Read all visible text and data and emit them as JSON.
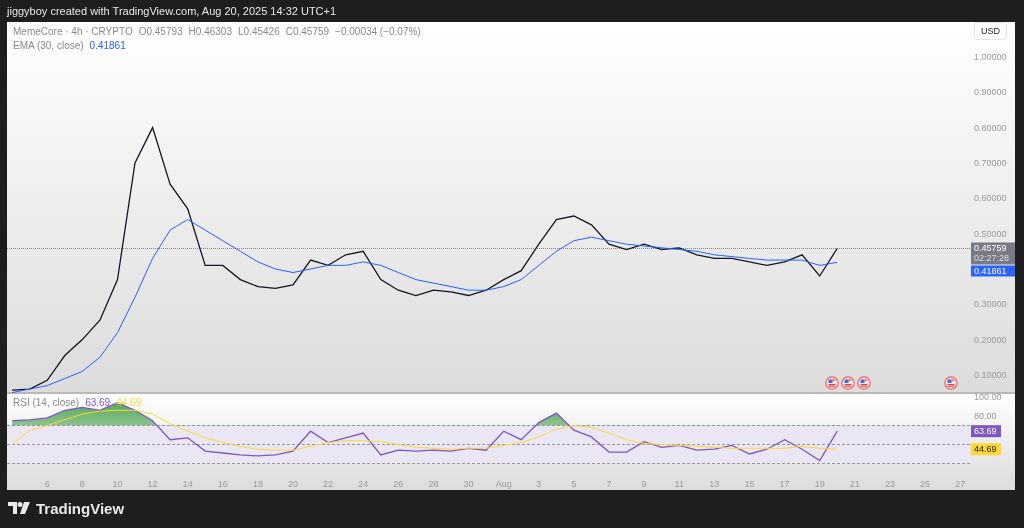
{
  "header": {
    "caption": "jiggyboy created with TradingView.com, Aug 20, 2025 14:32 UTC+1"
  },
  "chart": {
    "ohlc": [
      "O0.45793",
      "H0.46303",
      "L0.45426",
      "C0.45759"
    ],
    "change": "−0.00034 (−0.07%)",
    "ema_value": "0.41861",
    "currency": "USD",
    "price_badge": {
      "value": "0.45759",
      "countdown": "02:27:28"
    },
    "ema_badge": "0.41861",
    "events": [
      {
        "kind": "flag"
      },
      {
        "kind": "flag"
      },
      {
        "kind": "flag"
      },
      {
        "kind": "flag"
      }
    ],
    "chart_data": {
      "type": "line",
      "x": [
        "2025-07-04",
        "2025-07-05",
        "2025-07-06",
        "2025-07-07",
        "2025-07-08",
        "2025-07-09",
        "2025-07-10",
        "2025-07-11",
        "2025-07-12",
        "2025-07-13",
        "2025-07-14",
        "2025-07-15",
        "2025-07-16",
        "2025-07-17",
        "2025-07-18",
        "2025-07-19",
        "2025-07-20",
        "2025-07-21",
        "2025-07-22",
        "2025-07-23",
        "2025-07-24",
        "2025-07-25",
        "2025-07-26",
        "2025-07-27",
        "2025-07-28",
        "2025-07-29",
        "2025-07-30",
        "2025-07-31",
        "2025-08-01",
        "2025-08-02",
        "2025-08-03",
        "2025-08-04",
        "2025-08-05",
        "2025-08-06",
        "2025-08-07",
        "2025-08-08",
        "2025-08-09",
        "2025-08-10",
        "2025-08-11",
        "2025-08-12",
        "2025-08-13",
        "2025-08-14",
        "2025-08-15",
        "2025-08-16",
        "2025-08-17",
        "2025-08-18",
        "2025-08-19",
        "2025-08-20"
      ],
      "series": [
        {
          "name": "MemeCore · 4h · CRYPTO",
          "color": "#131722",
          "values": [
            0.057,
            0.06,
            0.085,
            0.155,
            0.2,
            0.255,
            0.37,
            0.7,
            0.8,
            0.64,
            0.57,
            0.41,
            0.41,
            0.37,
            0.35,
            0.345,
            0.355,
            0.425,
            0.41,
            0.44,
            0.45,
            0.37,
            0.34,
            0.325,
            0.34,
            0.335,
            0.325,
            0.34,
            0.37,
            0.395,
            0.47,
            0.54,
            0.55,
            0.525,
            0.47,
            0.455,
            0.47,
            0.455,
            0.46,
            0.44,
            0.43,
            0.43,
            0.42,
            0.41,
            0.42,
            0.44,
            0.38,
            0.458
          ]
        },
        {
          "name": "EMA (30, close)",
          "color": "#2962ff",
          "values": [
            0.05,
            0.06,
            0.07,
            0.09,
            0.11,
            0.15,
            0.22,
            0.32,
            0.43,
            0.51,
            0.54,
            0.51,
            0.48,
            0.45,
            0.42,
            0.4,
            0.39,
            0.4,
            0.41,
            0.41,
            0.42,
            0.41,
            0.39,
            0.37,
            0.36,
            0.35,
            0.34,
            0.34,
            0.35,
            0.37,
            0.41,
            0.45,
            0.48,
            0.49,
            0.48,
            0.47,
            0.465,
            0.46,
            0.455,
            0.45,
            0.44,
            0.435,
            0.43,
            0.425,
            0.425,
            0.425,
            0.41,
            0.419
          ]
        }
      ],
      "xlim": [
        "2025-07-03T17:00",
        "2025-08-30T03:00"
      ],
      "ylim": [
        0.049,
        1.099
      ],
      "yticks": [
        {
          "value": 1,
          "label": "1.00000"
        },
        {
          "value": 0.9,
          "label": "0.90000"
        },
        {
          "value": 0.8,
          "label": "0.80000"
        },
        {
          "value": 0.7,
          "label": "0.70000"
        },
        {
          "value": 0.6,
          "label": "0.60000"
        },
        {
          "value": 0.5,
          "label": "0.50000"
        },
        {
          "value": 0.3,
          "label": "0.30000"
        },
        {
          "value": 0.2,
          "label": "0.20000"
        },
        {
          "value": 0.1,
          "label": "0.10000"
        }
      ]
    }
  },
  "rsi": {
    "value": "63.69",
    "ma_value": "44.69",
    "value_badge": "63.69",
    "ma_badge": "44.69",
    "chart_data": {
      "type": "line",
      "x": [
        "2025-07-04",
        "2025-07-05",
        "2025-07-06",
        "2025-07-07",
        "2025-07-08",
        "2025-07-09",
        "2025-07-10",
        "2025-07-11",
        "2025-07-12",
        "2025-07-13",
        "2025-07-14",
        "2025-07-15",
        "2025-07-16",
        "2025-07-17",
        "2025-07-18",
        "2025-07-19",
        "2025-07-20",
        "2025-07-21",
        "2025-07-22",
        "2025-07-23",
        "2025-07-24",
        "2025-07-25",
        "2025-07-26",
        "2025-07-27",
        "2025-07-28",
        "2025-07-29",
        "2025-07-30",
        "2025-07-31",
        "2025-08-01",
        "2025-08-02",
        "2025-08-03",
        "2025-08-04",
        "2025-08-05",
        "2025-08-06",
        "2025-08-07",
        "2025-08-08",
        "2025-08-09",
        "2025-08-10",
        "2025-08-11",
        "2025-08-12",
        "2025-08-13",
        "2025-08-14",
        "2025-08-15",
        "2025-08-16",
        "2025-08-17",
        "2025-08-18",
        "2025-08-19",
        "2025-08-20"
      ],
      "series": [
        {
          "name": "RSI (14, close)",
          "color": "#7e57c2",
          "values": [
            75,
            76,
            78,
            86,
            89,
            86,
            94,
            86,
            75,
            55,
            57,
            43,
            41,
            39,
            38,
            39,
            43,
            64,
            52,
            57,
            62,
            39,
            44,
            43,
            44,
            43,
            46,
            44,
            64,
            55,
            73,
            83,
            65,
            58,
            42,
            42,
            53,
            47,
            49,
            44,
            45,
            49,
            40,
            45,
            55,
            45,
            33,
            64
          ]
        },
        {
          "color": "#fdd835",
          "values": [
            50,
            65,
            70,
            76,
            82,
            85,
            86,
            86,
            82,
            72,
            64,
            57,
            52,
            48,
            45,
            44,
            44,
            48,
            52,
            54,
            54,
            53,
            50,
            47,
            46,
            45,
            46,
            46,
            49,
            52,
            58,
            66,
            70,
            68,
            62,
            55,
            51,
            50,
            49,
            48,
            47,
            46,
            46,
            46,
            46,
            48,
            46,
            45
          ]
        }
      ],
      "xlim": [
        "2025-07-03T17:00",
        "2025-08-30T03:00"
      ],
      "ylim": [
        2.1,
        104.2
      ],
      "yticks": [
        {
          "value": 100,
          "label": "100.00"
        },
        {
          "value": 80,
          "label": "80.00"
        }
      ],
      "xticks": [
        {
          "value": "2025-07-06",
          "label": "6"
        },
        {
          "value": "2025-07-08",
          "label": "8"
        },
        {
          "value": "2025-07-10",
          "label": "10"
        },
        {
          "value": "2025-07-12",
          "label": "12"
        },
        {
          "value": "2025-07-14",
          "label": "14"
        },
        {
          "value": "2025-07-16",
          "label": "16"
        },
        {
          "value": "2025-07-18",
          "label": "18"
        },
        {
          "value": "2025-07-20",
          "label": "20"
        },
        {
          "value": "2025-07-22",
          "label": "22"
        },
        {
          "value": "2025-07-24",
          "label": "24"
        },
        {
          "value": "2025-07-26",
          "label": "26"
        },
        {
          "value": "2025-07-28",
          "label": "28"
        },
        {
          "value": "2025-07-30",
          "label": "30"
        },
        {
          "value": "2025-08-01",
          "label": "Aug"
        },
        {
          "value": "2025-08-03",
          "label": "3"
        },
        {
          "value": "2025-08-05",
          "label": "5"
        },
        {
          "value": "2025-08-07",
          "label": "7"
        },
        {
          "value": "2025-08-09",
          "label": "9"
        },
        {
          "value": "2025-08-11",
          "label": "11"
        },
        {
          "value": "2025-08-13",
          "label": "13"
        },
        {
          "value": "2025-08-15",
          "label": "15"
        },
        {
          "value": "2025-08-17",
          "label": "17"
        },
        {
          "value": "2025-08-19",
          "label": "19"
        },
        {
          "value": "2025-08-21",
          "label": "21"
        },
        {
          "value": "2025-08-23",
          "label": "23"
        },
        {
          "value": "2025-08-25",
          "label": "25"
        },
        {
          "value": "2025-08-27",
          "label": "27"
        }
      ]
    }
  },
  "footer": {
    "brand": "TradingView"
  }
}
